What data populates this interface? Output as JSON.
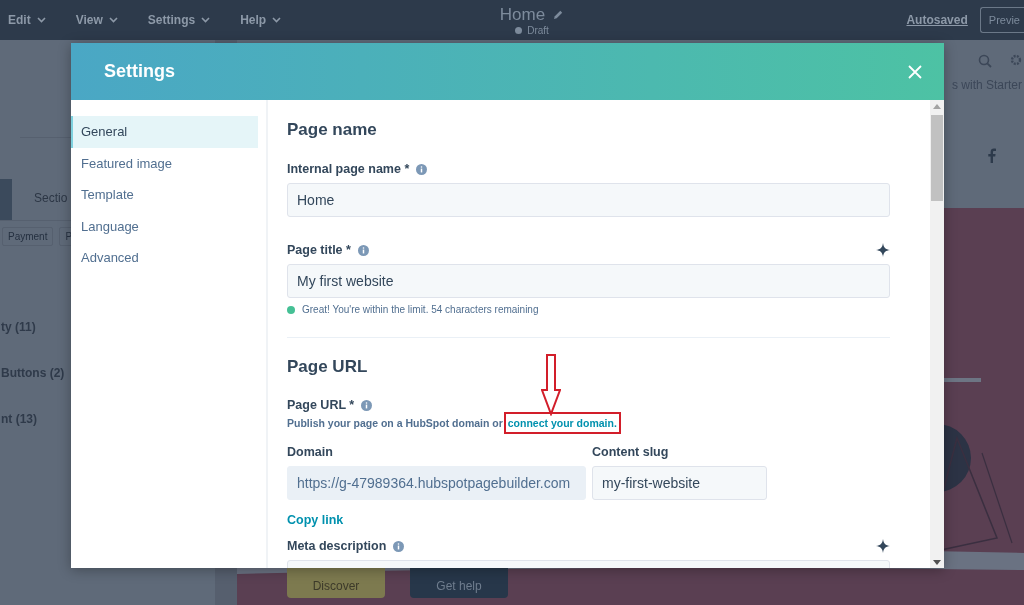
{
  "editor": {
    "menu": [
      {
        "label": "Edit"
      },
      {
        "label": "View"
      },
      {
        "label": "Settings"
      },
      {
        "label": "Help"
      }
    ],
    "page_title": "Home",
    "status": "Draft",
    "autosave": "Autosaved",
    "preview_button": "Previe",
    "sidebar": {
      "tab": "Sectio",
      "filters": [
        "Payment",
        "P"
      ],
      "categories": [
        "ty (11)",
        "Buttons (2)",
        "nt (13)"
      ]
    },
    "upsell": "s with Starter",
    "canvas_buttons": [
      "Discover",
      "Get help"
    ]
  },
  "modal": {
    "title": "Settings",
    "nav": [
      {
        "label": "General",
        "selected": true
      },
      {
        "label": "Featured image",
        "selected": false
      },
      {
        "label": "Template",
        "selected": false
      },
      {
        "label": "Language",
        "selected": false
      },
      {
        "label": "Advanced",
        "selected": false
      }
    ],
    "page_name": {
      "heading": "Page name",
      "internal_name": {
        "label": "Internal page name *",
        "value": "Home"
      },
      "page_title": {
        "label": "Page title *",
        "value": "My first website",
        "hint": "Great! You're within the limit. 54 characters remaining"
      }
    },
    "page_url": {
      "heading": "Page URL",
      "label": "Page URL *",
      "help": "Publish your page on a HubSpot domain or ",
      "help_link": "connect your domain.",
      "domain": {
        "label": "Domain",
        "value": "https://g-47989364.hubspotpagebuilder.com",
        "disabled": true
      },
      "slug": {
        "label": "Content slug",
        "value": "my-first-website",
        "disabled": false
      },
      "copy_link": "Copy link",
      "meta_label": "Meta description"
    }
  }
}
